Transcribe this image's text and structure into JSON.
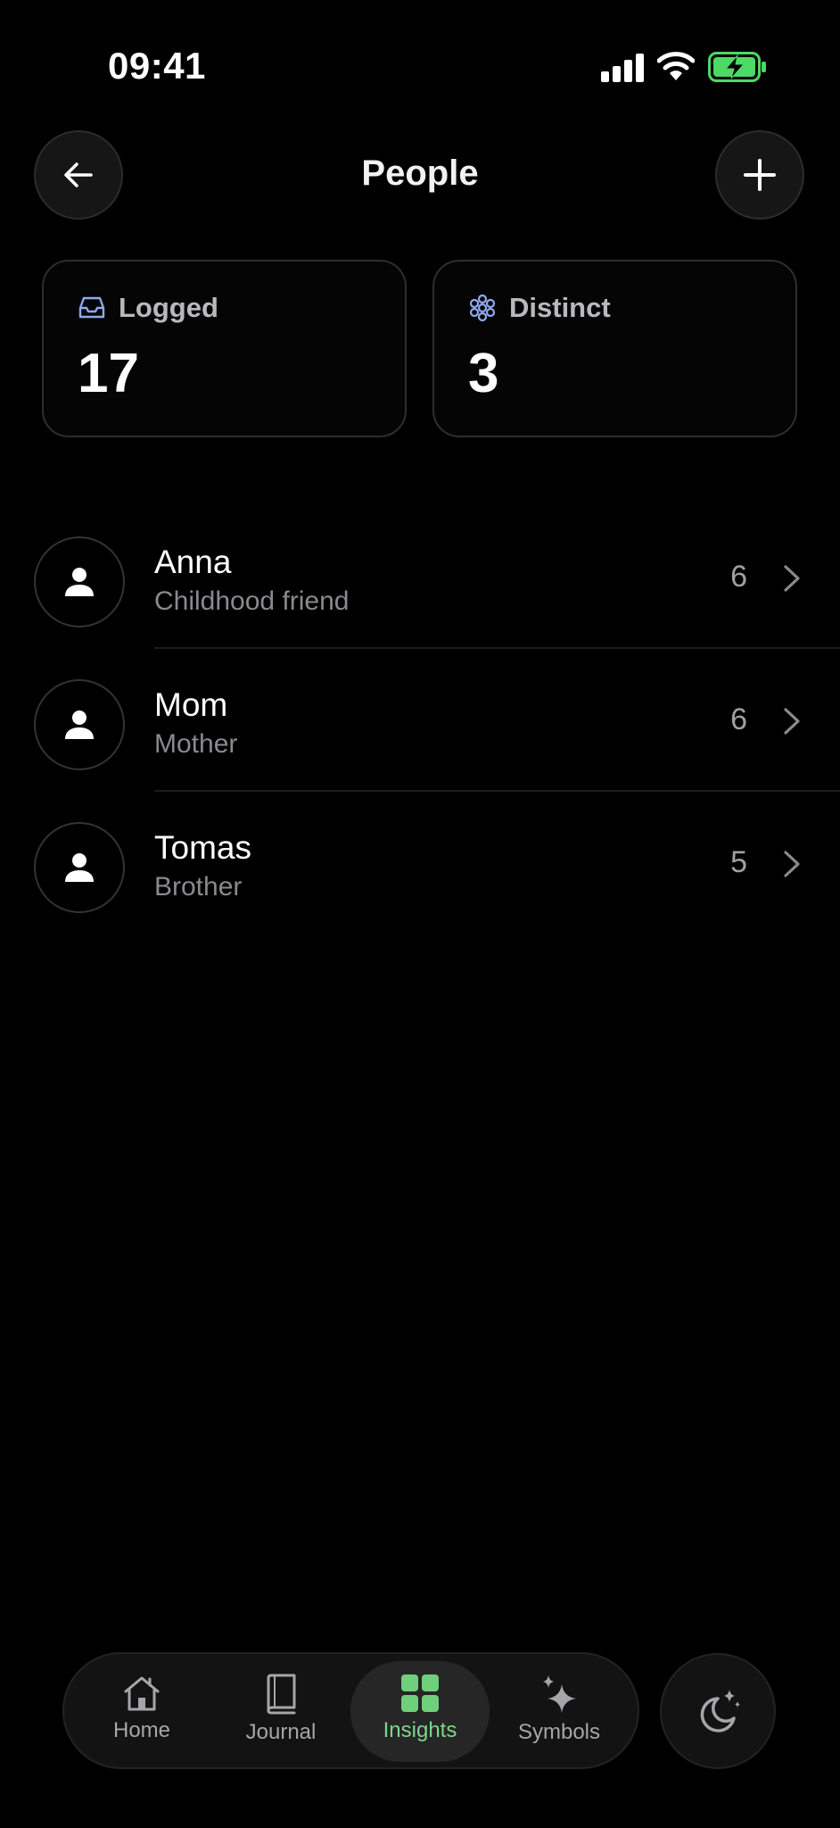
{
  "status_bar": {
    "time": "09:41"
  },
  "header": {
    "title": "People"
  },
  "stats": {
    "logged": {
      "label": "Logged",
      "value": "17"
    },
    "distinct": {
      "label": "Distinct",
      "value": "3"
    }
  },
  "people": [
    {
      "name": "Anna",
      "relation": "Childhood friend",
      "count": "6"
    },
    {
      "name": "Mom",
      "relation": "Mother",
      "count": "6"
    },
    {
      "name": "Tomas",
      "relation": "Brother",
      "count": "5"
    }
  ],
  "nav": {
    "tabs": [
      {
        "label": "Home",
        "icon": "home-icon"
      },
      {
        "label": "Journal",
        "icon": "book-icon"
      },
      {
        "label": "Insights",
        "icon": "grid-icon",
        "active": true
      },
      {
        "label": "Symbols",
        "icon": "sparkle-icon"
      }
    ],
    "theme_icon": "moon-icon"
  },
  "colors": {
    "accent": "#6fcf7c",
    "background": "#000000",
    "stat_icon": "#8fa8f0"
  }
}
